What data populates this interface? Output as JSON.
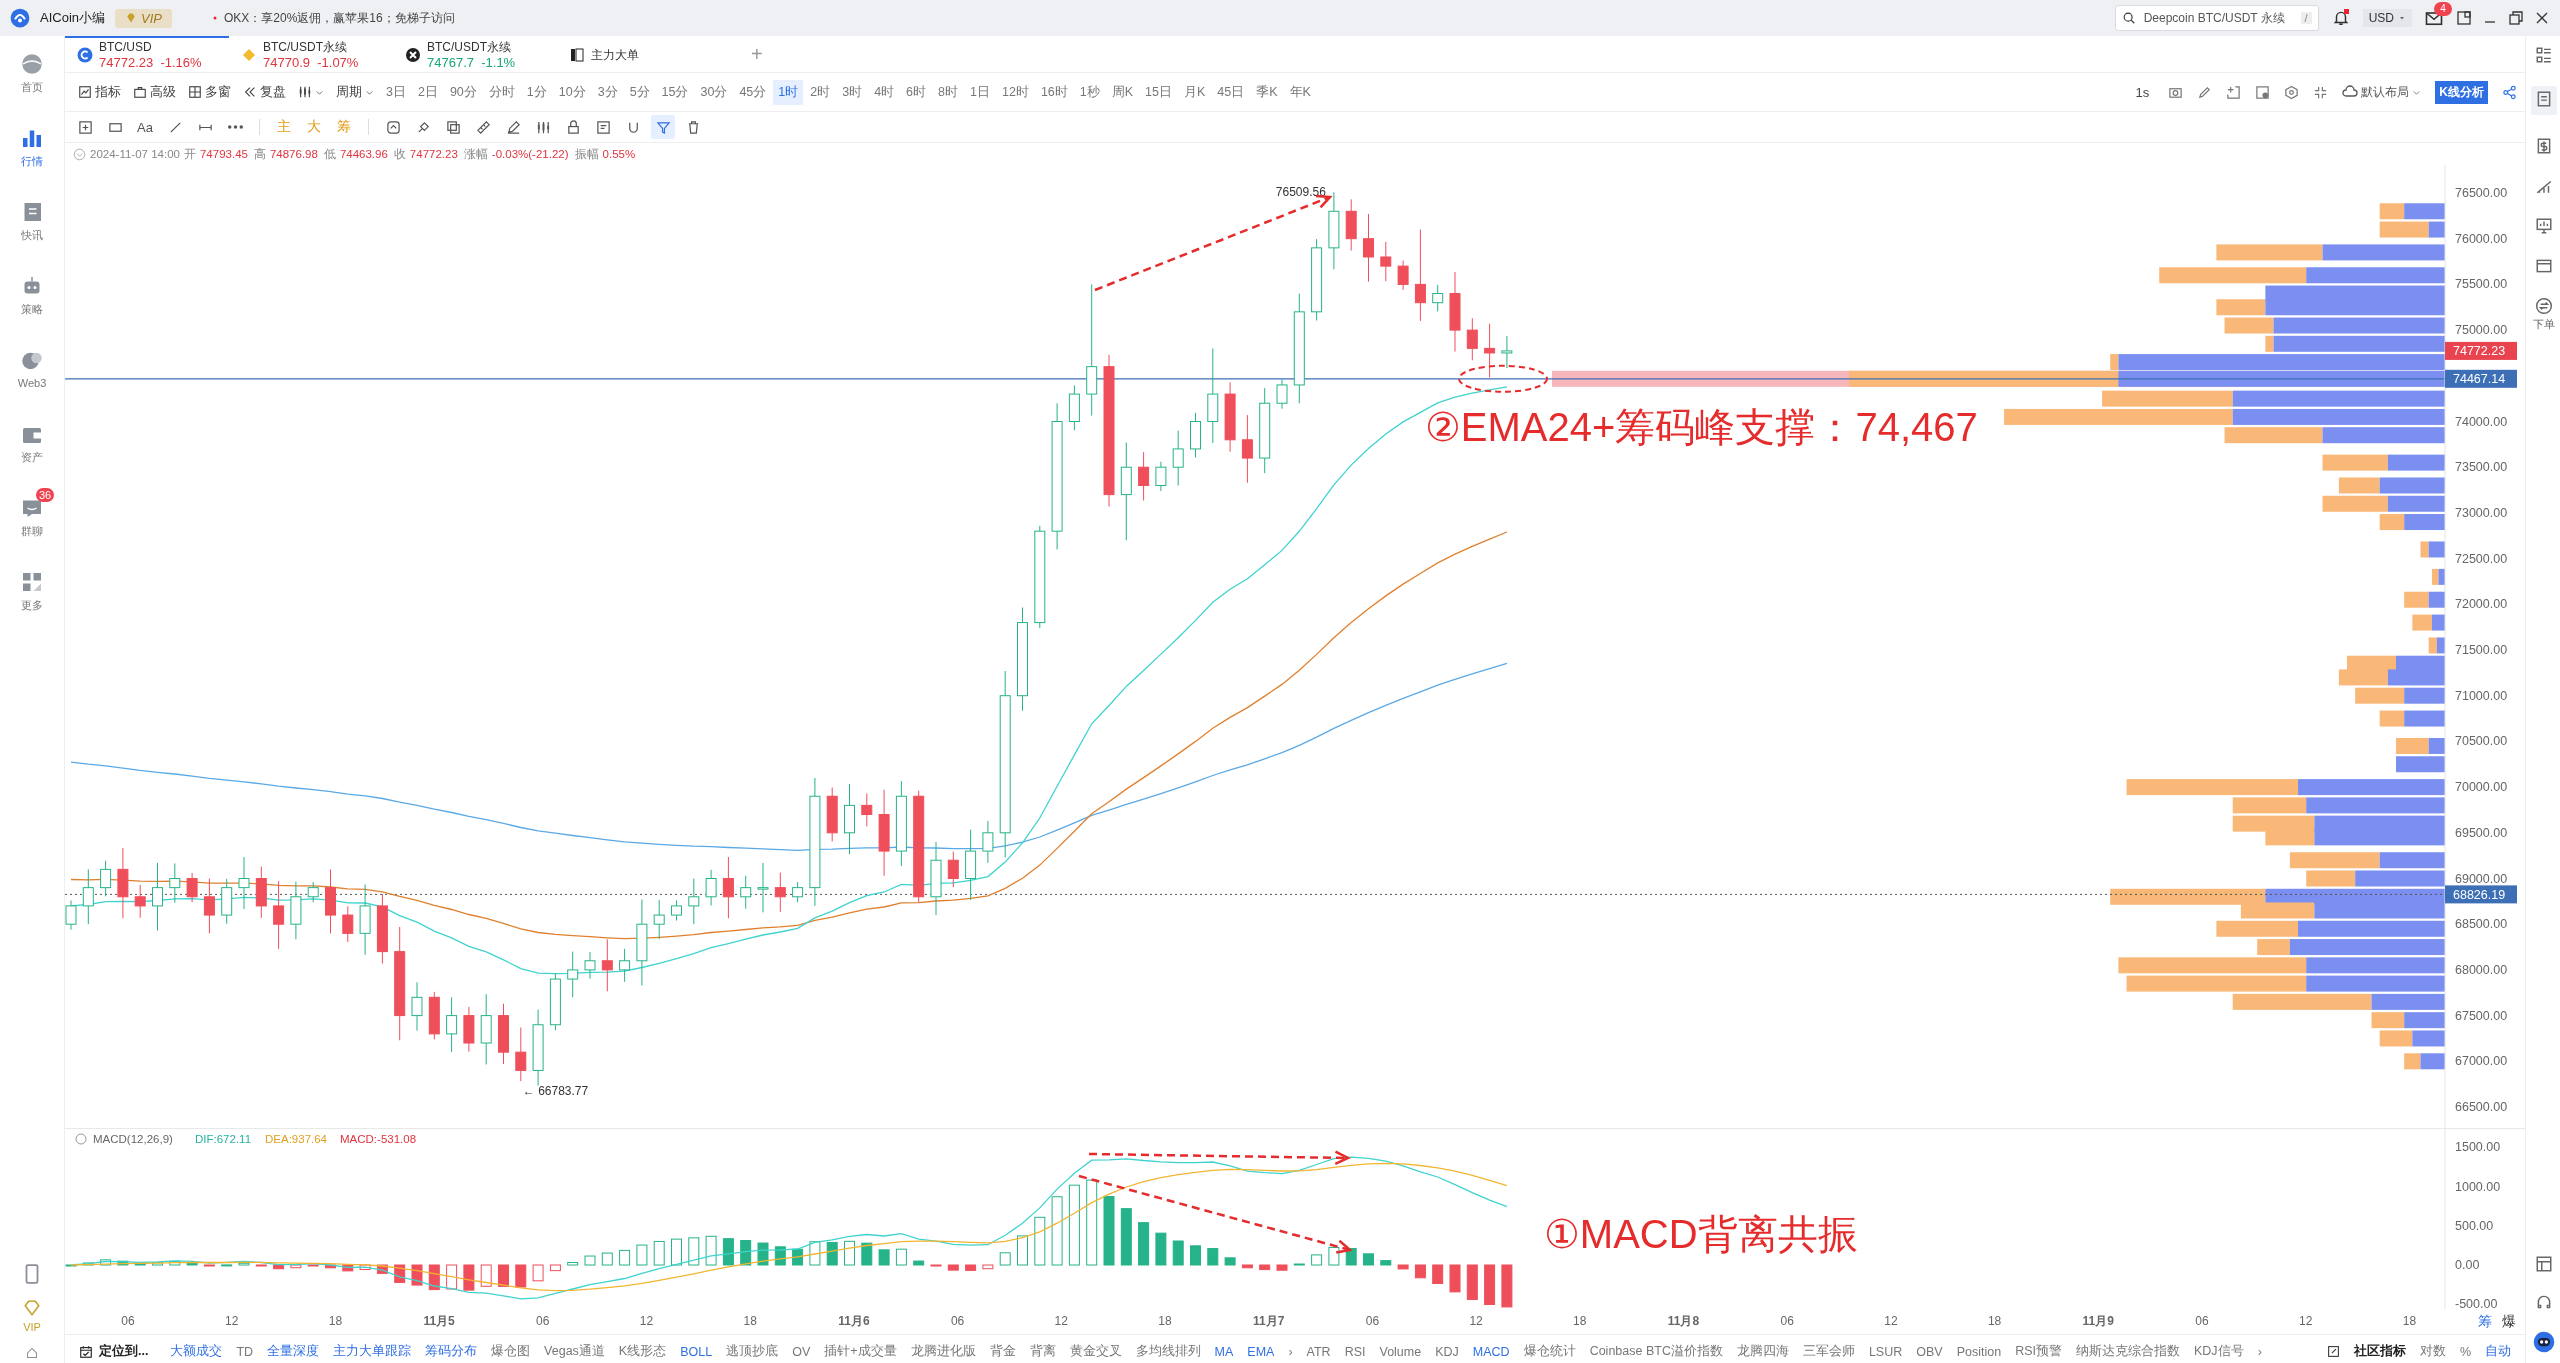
{
  "top_bar": {
    "app_name": "AICoin小编",
    "vip": "VIP",
    "news": "OKX：享20%返佣，赢苹果16；免梯子访问",
    "search": {
      "placeholder": "Deepcoin BTC/USDT 永续",
      "shortcut": "/"
    },
    "bell_dot": true,
    "currency": "USD",
    "mail_badge": "4"
  },
  "sidebar": {
    "items": [
      {
        "label": "首页",
        "kind": "globe",
        "selected": false
      },
      {
        "label": "行情",
        "kind": "bars",
        "selected": true
      },
      {
        "label": "快讯",
        "kind": "news",
        "selected": false
      },
      {
        "label": "策略",
        "kind": "robot",
        "selected": false
      },
      {
        "label": "Web3",
        "kind": "web3",
        "selected": false
      },
      {
        "label": "资产",
        "kind": "wallet",
        "selected": false
      },
      {
        "label": "群聊",
        "kind": "chat",
        "selected": false,
        "badge": "36"
      },
      {
        "label": "更多",
        "kind": "more",
        "selected": false
      }
    ],
    "vip": "VIP"
  },
  "tabs": [
    {
      "symbol": "BTC/USD",
      "price": "74772.23",
      "change": "-1.16%",
      "falling": true,
      "kind": "coin",
      "selected": true
    },
    {
      "symbol": "BTC/USDT永续",
      "price": "74770.9",
      "change": "-1.07%",
      "falling": true,
      "kind": "diamond",
      "selected": false
    },
    {
      "symbol": "BTC/USDT永续",
      "price": "74767.7",
      "change": "-1.1%",
      "falling": false,
      "kind": "cross",
      "selected": false
    },
    {
      "symbol": "主力大单",
      "kind": "book",
      "selected": false
    }
  ],
  "add_tab": "+",
  "toolbar": {
    "items": [
      {
        "label": "指标",
        "kind": "chart",
        "dropdown": false
      },
      {
        "label": "高级",
        "kind": "case",
        "dropdown": false
      },
      {
        "label": "多窗",
        "kind": "grid",
        "dropdown": false
      },
      {
        "label": "复盘",
        "kind": "rewind",
        "dropdown": false
      },
      {
        "kind": "candles",
        "dropdown": true
      },
      {
        "label": "周期",
        "kind": "none",
        "dropdown": true
      }
    ],
    "periods": [
      {
        "label": "3日",
        "selected": false
      },
      {
        "label": "2日",
        "selected": false
      },
      {
        "label": "90分",
        "selected": false
      },
      {
        "label": "分时",
        "selected": false
      },
      {
        "label": "1分",
        "selected": false
      },
      {
        "label": "10分",
        "selected": false
      },
      {
        "label": "3分",
        "selected": false
      },
      {
        "label": "5分",
        "selected": false
      },
      {
        "label": "15分",
        "selected": false
      },
      {
        "label": "30分",
        "selected": false
      },
      {
        "label": "45分",
        "selected": false
      },
      {
        "label": "1时",
        "selected": true
      },
      {
        "label": "2时",
        "selected": false
      },
      {
        "label": "3时",
        "selected": false
      },
      {
        "label": "4时",
        "selected": false
      },
      {
        "label": "6时",
        "selected": false
      },
      {
        "label": "8时",
        "selected": false
      },
      {
        "label": "1日",
        "selected": false
      },
      {
        "label": "12时",
        "selected": false
      },
      {
        "label": "16时",
        "selected": false
      },
      {
        "label": "1秒",
        "selected": false
      },
      {
        "label": "周K",
        "selected": false
      },
      {
        "label": "15日",
        "selected": false
      },
      {
        "label": "月K",
        "selected": false
      },
      {
        "label": "45日",
        "selected": false
      },
      {
        "label": "季K",
        "selected": false
      },
      {
        "label": "年K",
        "selected": false
      }
    ],
    "refresh": "1s",
    "layout": "默认布局",
    "analysis_button": "K线分析"
  },
  "drawing_tools": [
    {
      "kind": "crosshair",
      "selected": false
    },
    {
      "kind": "rect",
      "selected": false
    },
    {
      "kind": "text",
      "label": "Aa",
      "selected": false
    },
    {
      "kind": "line",
      "selected": false
    },
    {
      "kind": "ruler",
      "selected": false
    },
    {
      "kind": "dots",
      "selected": false
    },
    {
      "kind": "tag",
      "label": "主",
      "selected": false
    },
    {
      "kind": "tag",
      "label": "大",
      "selected": false
    },
    {
      "kind": "tag",
      "label": "筹",
      "selected": false
    },
    {
      "kind": "swap",
      "selected": false
    },
    {
      "kind": "brush",
      "selected": false
    },
    {
      "kind": "copy",
      "selected": false
    },
    {
      "kind": "ruler2",
      "selected": false
    },
    {
      "kind": "pen",
      "selected": false
    },
    {
      "kind": "candles",
      "selected": false
    },
    {
      "kind": "lock",
      "selected": false
    },
    {
      "kind": "note",
      "selected": false
    },
    {
      "kind": "magnet",
      "selected": false
    },
    {
      "kind": "filter",
      "selected": true
    },
    {
      "kind": "trash",
      "selected": false
    }
  ],
  "info_line": {
    "time": "2024-11-07 14:00",
    "fields": [
      {
        "label": "开",
        "value": "74793.45"
      },
      {
        "label": "高",
        "value": "74876.98"
      },
      {
        "label": "低",
        "value": "74463.96"
      },
      {
        "label": "收",
        "value": "74772.23"
      },
      {
        "label": "涨幅",
        "value": "-0.03%(-21.22)"
      },
      {
        "label": "振幅",
        "value": "0.55%"
      }
    ]
  },
  "chart": {
    "price_ticks": [
      "76500.00",
      "76000.00",
      "75500.00",
      "75000.00",
      "74000.00",
      "73500.00",
      "73000.00",
      "72500.00",
      "72000.00",
      "71500.00",
      "71000.00",
      "70500.00",
      "70000.00",
      "69500.00",
      "69000.00",
      "68500.00",
      "68000.00",
      "67500.00",
      "67000.00",
      "66500.00"
    ],
    "price_tags": [
      {
        "value": "74772.23",
        "kind": "last"
      },
      {
        "value": "74467.14",
        "kind": "line"
      },
      {
        "value": "68826.19",
        "kind": "line"
      }
    ],
    "high_label": "76509.56",
    "low_label": "← 66783.77",
    "annotation": "②EMA24+筹码峰支撑：74,467"
  },
  "macd": {
    "title": "MACD(12,26,9)",
    "dif": "DIF:672.11",
    "dea": "DEA:937.64",
    "macd": "MACD:-531.08",
    "ticks": [
      "1500.00",
      "1000.00",
      "500.00",
      "0.00",
      "-500.00"
    ],
    "annotation": "①MACD背离共振"
  },
  "time_axis": {
    "labels": [
      {
        "text": "06",
        "bold": false
      },
      {
        "text": "12",
        "bold": false
      },
      {
        "text": "18",
        "bold": false
      },
      {
        "text": "11月5",
        "bold": true
      },
      {
        "text": "06",
        "bold": false
      },
      {
        "text": "12",
        "bold": false
      },
      {
        "text": "18",
        "bold": false
      },
      {
        "text": "11月6",
        "bold": true
      },
      {
        "text": "06",
        "bold": false
      },
      {
        "text": "12",
        "bold": false
      },
      {
        "text": "18",
        "bold": false
      },
      {
        "text": "11月7",
        "bold": true
      },
      {
        "text": "06",
        "bold": false
      },
      {
        "text": "12",
        "bold": false
      },
      {
        "text": "18",
        "bold": false
      },
      {
        "text": "11月8",
        "bold": true
      },
      {
        "text": "06",
        "bold": false
      },
      {
        "text": "12",
        "bold": false
      },
      {
        "text": "18",
        "bold": false
      },
      {
        "text": "11月9",
        "bold": true
      },
      {
        "text": "06",
        "bold": false
      },
      {
        "text": "12",
        "bold": false
      },
      {
        "text": "18",
        "bold": false
      }
    ],
    "switches": [
      {
        "label": "筹",
        "active": true
      },
      {
        "label": "爆",
        "active": false
      }
    ]
  },
  "bottom_bar": {
    "locate": "定位到...",
    "indicators": [
      {
        "label": "大额成交",
        "active": true
      },
      {
        "label": "TD",
        "active": false
      },
      {
        "label": "全量深度",
        "active": true
      },
      {
        "label": "主力大单跟踪",
        "active": true
      },
      {
        "label": "筹码分布",
        "active": true
      },
      {
        "label": "爆仓图",
        "active": false
      },
      {
        "label": "Vegas通道",
        "active": false
      },
      {
        "label": "K线形态",
        "active": false
      },
      {
        "label": "BOLL",
        "active": true
      },
      {
        "label": "逃顶抄底",
        "active": false
      },
      {
        "label": "OV",
        "active": false
      },
      {
        "label": "插针+成交量",
        "active": false
      },
      {
        "label": "龙腾进化版",
        "active": false
      },
      {
        "label": "背金",
        "active": false
      },
      {
        "label": "背离",
        "active": false
      },
      {
        "label": "黄金交叉",
        "active": false
      },
      {
        "label": "多均线排列",
        "active": false
      },
      {
        "label": "MA",
        "active": true
      },
      {
        "label": "EMA",
        "active": true
      },
      {
        "label": "›",
        "active": false
      },
      {
        "label": "ATR",
        "active": false
      },
      {
        "label": "RSI",
        "active": false
      },
      {
        "label": "Volume",
        "active": false
      },
      {
        "label": "KDJ",
        "active": false
      },
      {
        "label": "MACD",
        "active": true
      },
      {
        "label": "爆仓统计",
        "active": false
      },
      {
        "label": "Coinbase BTC溢价指数",
        "active": false
      },
      {
        "label": "龙腾四海",
        "active": false
      },
      {
        "label": "三军会师",
        "active": false
      },
      {
        "label": "LSUR",
        "active": false
      },
      {
        "label": "OBV",
        "active": false
      },
      {
        "label": "Position",
        "active": false
      },
      {
        "label": "RSI预警",
        "active": false
      },
      {
        "label": "纳斯达克综合指数",
        "active": false
      },
      {
        "label": "KDJ信号",
        "active": false
      },
      {
        "label": "›",
        "active": false
      }
    ],
    "community": "社区指标",
    "options": [
      {
        "label": "对数",
        "active": false
      },
      {
        "label": "%",
        "active": false
      },
      {
        "label": "自动",
        "active": true
      }
    ]
  },
  "right_sidebar": {
    "order_label": "下单"
  }
}
